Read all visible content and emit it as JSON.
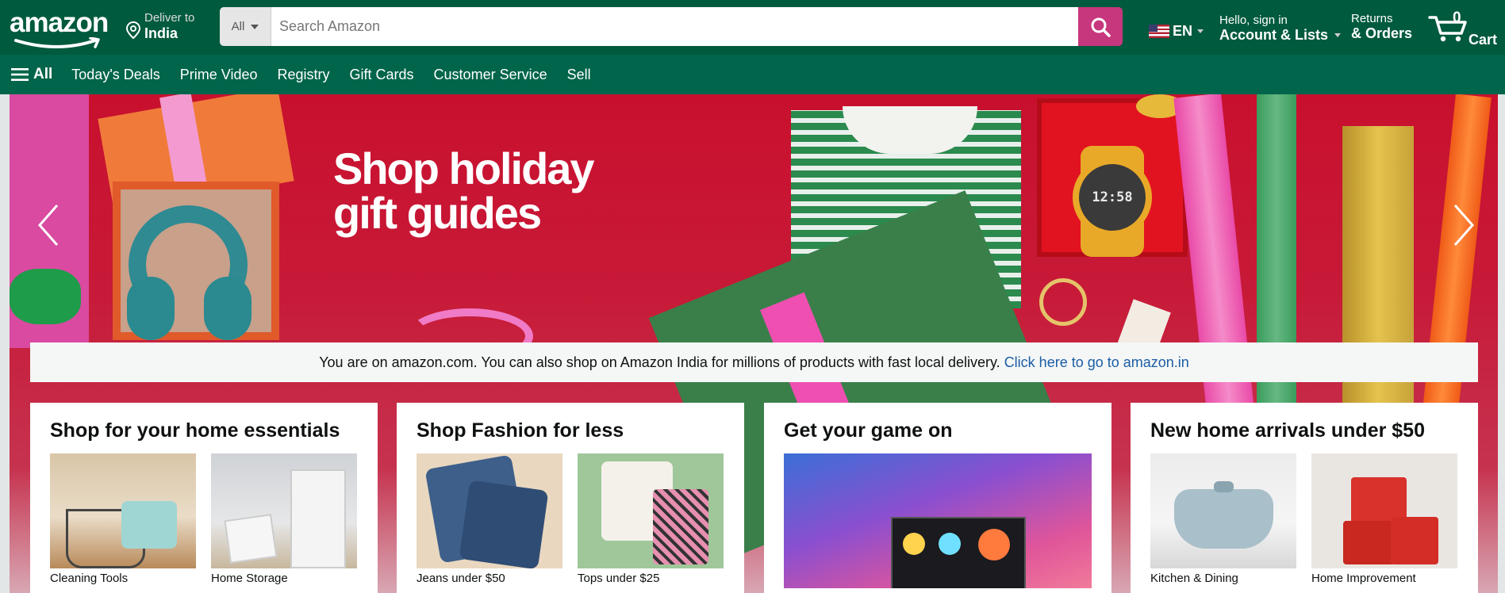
{
  "header": {
    "logo": "amazon",
    "deliver_label": "Deliver to",
    "deliver_location": "India",
    "search_category": "All",
    "search_placeholder": "Search Amazon",
    "language": "EN",
    "account_greeting": "Hello, sign in",
    "account_label": "Account & Lists",
    "returns_label": "Returns",
    "orders_label": "& Orders",
    "cart_count": "0",
    "cart_label": "Cart"
  },
  "nav": {
    "all_label": "All",
    "links": [
      "Today's Deals",
      "Prime Video",
      "Registry",
      "Gift Cards",
      "Customer Service",
      "Sell"
    ]
  },
  "hero": {
    "title_line1": "Shop holiday",
    "title_line2": "gift guides",
    "watch_time": "12:58"
  },
  "notice": {
    "text": "You are on amazon.com. You can also shop on Amazon India for millions of products with fast local delivery.",
    "link": "Click here to go to amazon.in"
  },
  "cards": [
    {
      "title": "Shop for your home essentials",
      "tiles": [
        "Cleaning Tools",
        "Home Storage"
      ]
    },
    {
      "title": "Shop Fashion for less",
      "tiles": [
        "Jeans under $50",
        "Tops under $25"
      ]
    },
    {
      "title": "Get your game on",
      "tiles": []
    },
    {
      "title": "New home arrivals under $50",
      "tiles": [
        "Kitchen & Dining",
        "Home Improvement"
      ]
    }
  ],
  "colors": {
    "header_bg": "#005a3e",
    "nav_bg": "#00654a",
    "search_button": "#c7377e",
    "hero_red": "#c8102e",
    "link_blue": "#1a5da5"
  }
}
